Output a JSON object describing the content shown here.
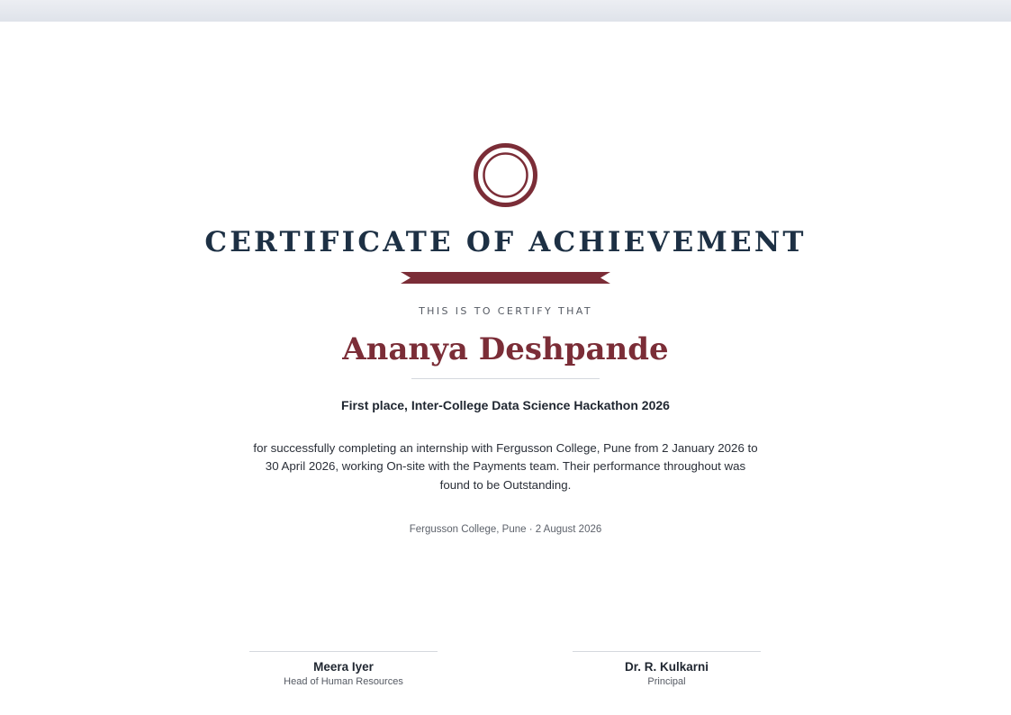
{
  "certificate": {
    "title": "CERTIFICATE OF ACHIEVEMENT",
    "certify_label": "THIS IS TO CERTIFY THAT",
    "recipient_name": "Ananya Deshpande",
    "achievement": "First place, Inter-College Data Science Hackathon 2026",
    "body_lines": [
      "for successfully completing an internship with Fergusson College, Pune from 2 January 2026 to",
      "30 April 2026, working On-site with the Payments team. Their performance throughout was",
      "found to be Outstanding."
    ],
    "place_date": "Fergusson College, Pune · 2 August 2026",
    "seal_icon": "seal-icon",
    "ribbon_icon": "ribbon-icon"
  },
  "signatories": [
    {
      "name": "Meera Iyer",
      "role": "Head of Human Resources"
    },
    {
      "name": "Dr. R. Kulkarni",
      "role": "Principal"
    }
  ],
  "colors": {
    "accent": "#7b2d37",
    "title": "#1d3044",
    "rule": "#d5d8de"
  }
}
